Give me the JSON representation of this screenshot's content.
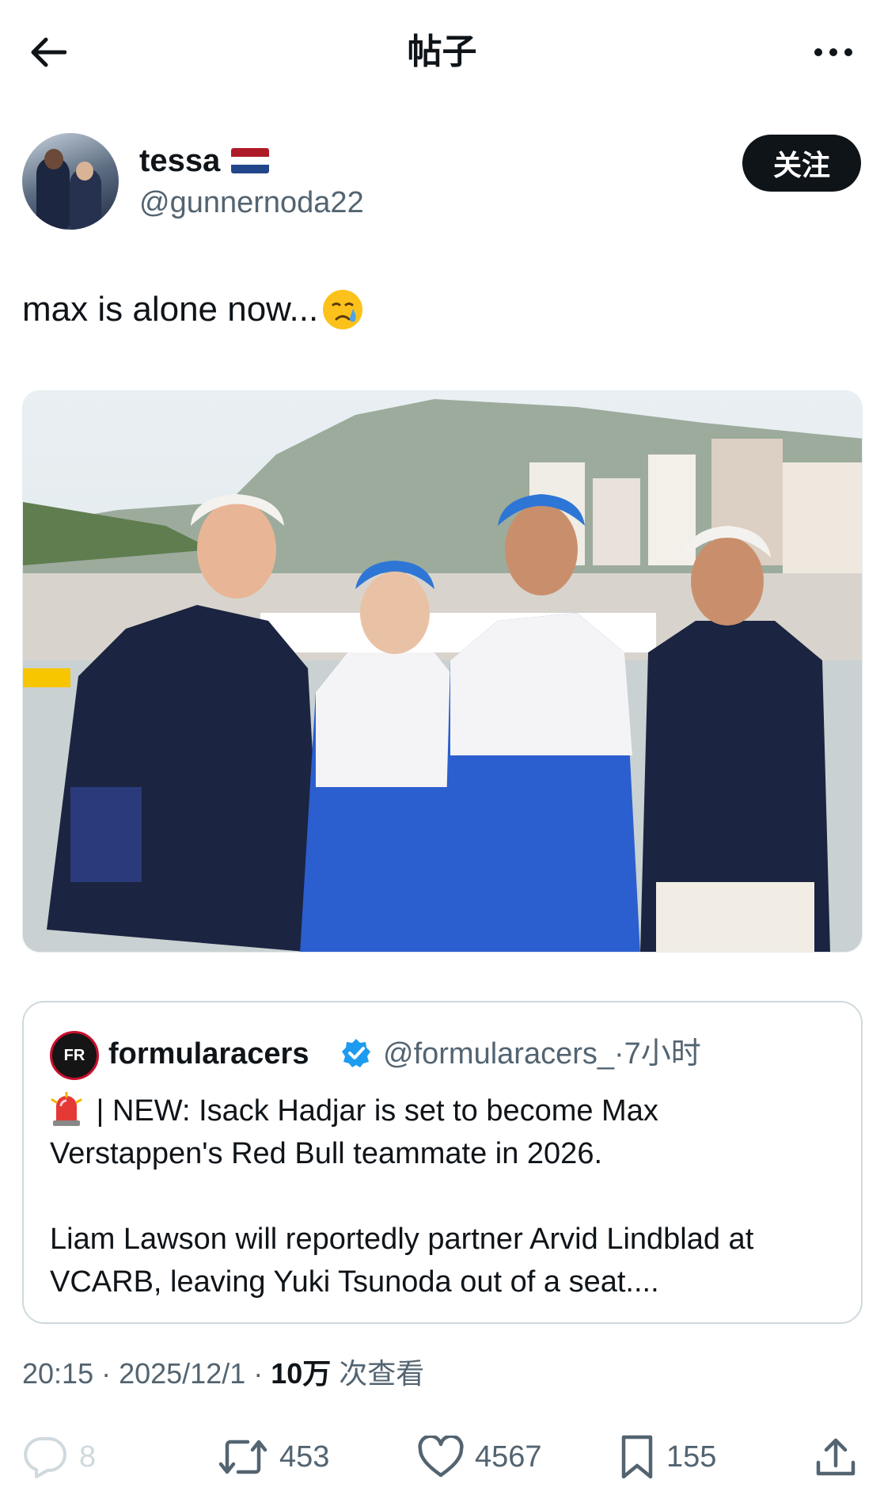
{
  "header": {
    "title": "帖子",
    "back_icon": "back-arrow-icon",
    "more_icon": "more-options-icon"
  },
  "author": {
    "display_name": "tessa",
    "flag_icon": "netherlands-flag-icon",
    "handle": "@gunnernoda22",
    "follow_label": "关注"
  },
  "post": {
    "text": "max is alone now...",
    "emoji_icon": "crying-face-emoji"
  },
  "quoted_post": {
    "name": "formularacers",
    "handle": "@formularacers_",
    "time": "·7小时",
    "verified_icon": "verified-badge-icon",
    "siren_icon": "police-light-emoji",
    "line1": " | NEW: Isack Hadjar is set to become Max Verstappen's Red Bull teammate in 2026.",
    "line2": "Liam Lawson will reportedly partner Arvid Lindblad at VCARB, leaving Yuki Tsunoda out of a seat...."
  },
  "meta": {
    "time": "20:15",
    "separator1": " · ",
    "date": "2025/12/1",
    "separator2": " · ",
    "views_count": "10万",
    "views_label": " 次查看"
  },
  "actions": {
    "reply_count": "8",
    "retweet_count": "453",
    "like_count": "4567",
    "bookmark_count": "155",
    "share_icon": "share-icon"
  },
  "colors": {
    "text": "#0f1419",
    "secondary": "#536471",
    "verified": "#1d9bf0",
    "follow_bg": "#0f1419"
  }
}
